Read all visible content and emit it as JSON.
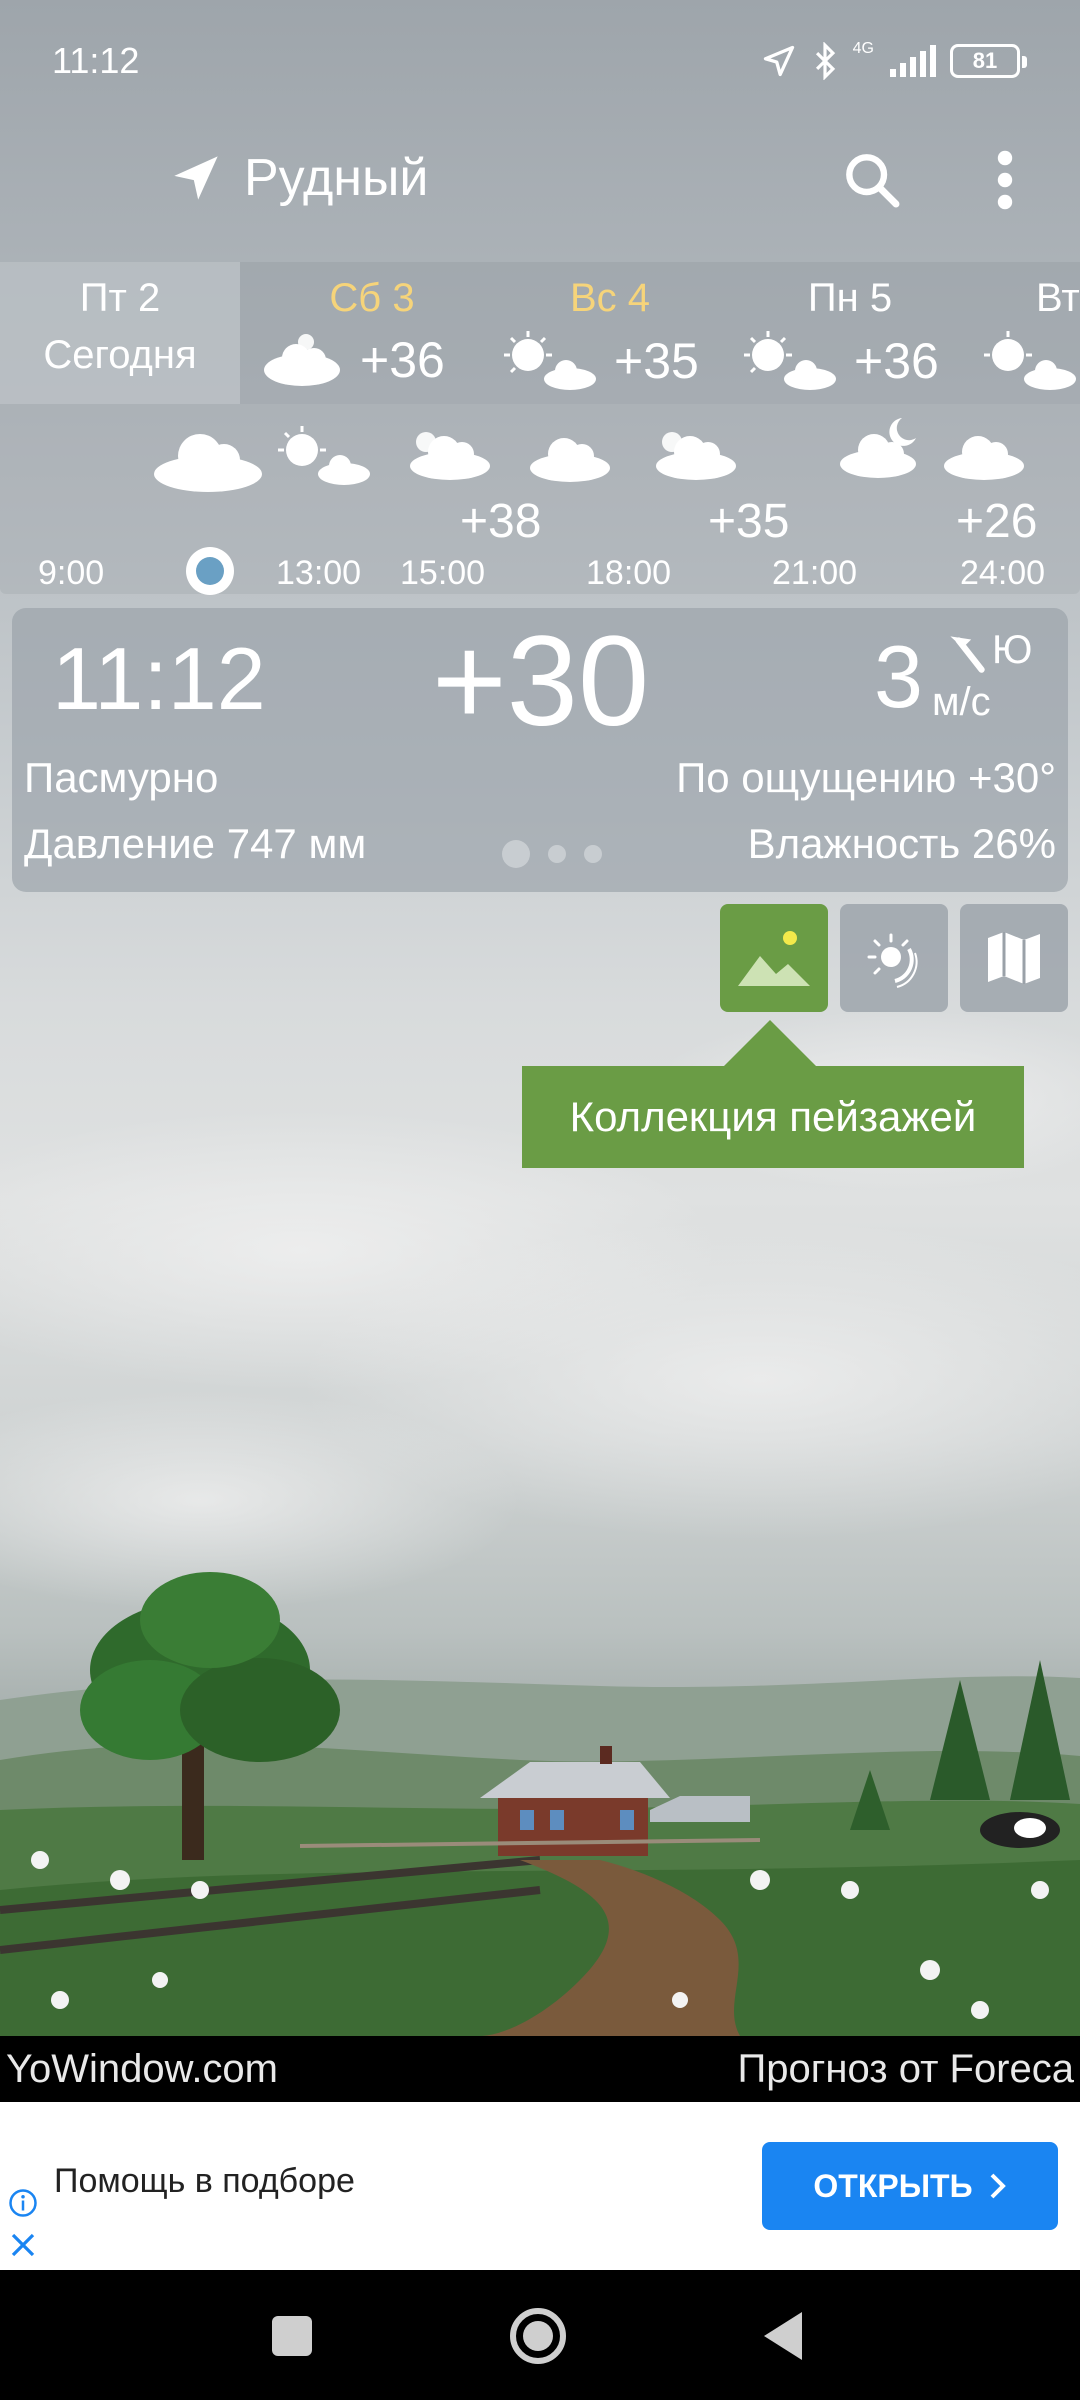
{
  "status": {
    "time": "11:12",
    "network": "4G",
    "battery": "81"
  },
  "toolbar": {
    "location": "Рудный",
    "icons": [
      "location-arrow-icon",
      "search-icon",
      "more-vert-icon"
    ]
  },
  "days": [
    {
      "name": "Пт 2",
      "sub": "Сегодня",
      "selected": true
    },
    {
      "name": "Сб 3",
      "temp": "+36",
      "weekend": true,
      "icon": "cloud-icon"
    },
    {
      "name": "Вс 4",
      "temp": "+35",
      "weekend": true,
      "icon": "sun-cloud-icon"
    },
    {
      "name": "Пн 5",
      "temp": "+36",
      "icon": "sun-cloud-icon"
    },
    {
      "name": "Вт",
      "icon": "sun-cloud-icon"
    }
  ],
  "hourly": {
    "times": [
      "9:00",
      "13:00",
      "15:00",
      "18:00",
      "21:00",
      "24:00"
    ],
    "temps": [
      "+38",
      "+35",
      "+26"
    ]
  },
  "current": {
    "time": "11:12",
    "temp": "+30",
    "wind_speed": "3",
    "wind_dir": "Ю",
    "wind_unit": "м/с",
    "condition": "Пасмурно",
    "pressure": "Давление 747 мм",
    "feels_like": "По ощущению +30°",
    "humidity": "Влажность 26%"
  },
  "tooltip": "Коллекция пейзажей",
  "credit": {
    "left": "YoWindow.com",
    "right": "Прогноз от Foreca"
  },
  "ad": {
    "text": "Помощь в подборе",
    "button": "ОТКРЫТЬ"
  },
  "colors": {
    "accent_green": "#6a9c45",
    "weekend": "#f6d47a",
    "ad_button": "#1a85f2"
  }
}
